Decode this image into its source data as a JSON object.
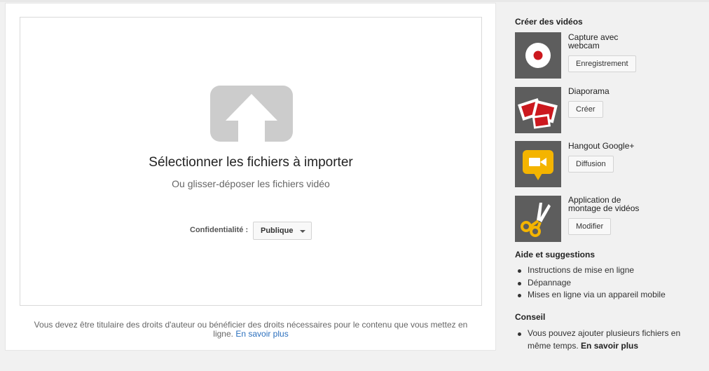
{
  "upload": {
    "title": "Sélectionner les fichiers à importer",
    "subtitle": "Ou glisser-déposer les fichiers vidéo",
    "privacy_label": "Confidentialité :",
    "privacy_value": "Publique",
    "copyright_text": "Vous devez être titulaire des droits d'auteur ou bénéficier des droits nécessaires pour le contenu que vous mettez en ligne.",
    "learn_more": "En savoir plus"
  },
  "create": {
    "heading": "Créer des vidéos",
    "items": [
      {
        "label": "Capture avec webcam",
        "button": "Enregistrement",
        "icon": "webcam-record-icon"
      },
      {
        "label": "Diaporama",
        "button": "Créer",
        "icon": "slideshow-icon"
      },
      {
        "label": "Hangout Google+",
        "button": "Diffusion",
        "icon": "hangout-camera-icon"
      },
      {
        "label": "Application de montage de vidéos",
        "button": "Modifier",
        "icon": "scissors-icon"
      }
    ]
  },
  "help": {
    "heading": "Aide et suggestions",
    "items": [
      "Instructions de mise en ligne",
      "Dépannage",
      "Mises en ligne via un appareil mobile"
    ]
  },
  "tip": {
    "heading": "Conseil",
    "text": "Vous pouvez ajouter plusieurs fichiers en même temps.",
    "learn_more": "En savoir plus"
  },
  "colors": {
    "record_red": "#cc181e",
    "hangout_yellow": "#f4b400",
    "link_blue": "#2a6fbd",
    "thumb_gray": "#5d5d5d",
    "upload_icon_gray": "#cccccc"
  }
}
